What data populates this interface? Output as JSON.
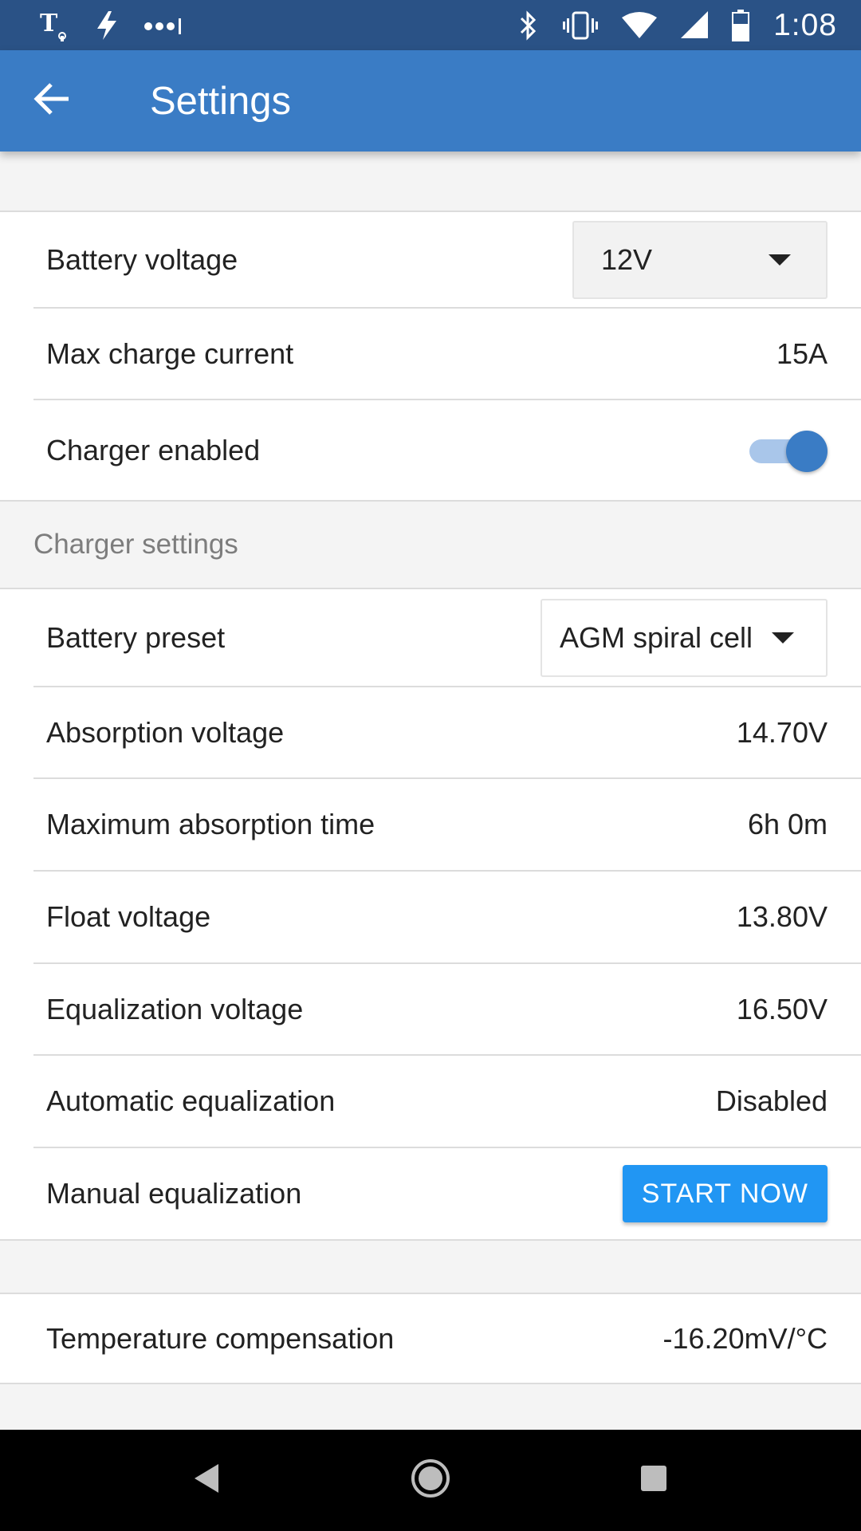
{
  "status_bar": {
    "carrier_icon": "tmobile-icon",
    "time": "1:08",
    "icons": [
      "tmobile-icon",
      "charging-bolt-icon",
      "signal-dots-icon",
      "bluetooth-icon",
      "vibrate-icon",
      "wifi-icon",
      "cell-signal-icon",
      "battery-icon"
    ]
  },
  "app_bar": {
    "title": "Settings",
    "back_icon": "arrow-left-icon",
    "color": "#3a7cc5"
  },
  "general": {
    "battery_voltage": {
      "label": "Battery voltage",
      "value": "12V"
    },
    "max_charge_current": {
      "label": "Max charge current",
      "value": "15A"
    },
    "charger_enabled": {
      "label": "Charger enabled",
      "on": true
    }
  },
  "charger_settings": {
    "header": "Charger settings",
    "battery_preset": {
      "label": "Battery preset",
      "value": "AGM spiral cell"
    },
    "rows": [
      {
        "label": "Absorption voltage",
        "value": "14.70V"
      },
      {
        "label": "Maximum absorption time",
        "value": "6h 0m"
      },
      {
        "label": "Float voltage",
        "value": "13.80V"
      },
      {
        "label": "Equalization voltage",
        "value": "16.50V"
      },
      {
        "label": "Automatic equalization",
        "value": "Disabled"
      }
    ],
    "manual_equalization": {
      "label": "Manual equalization",
      "button": "START NOW"
    }
  },
  "temperature": {
    "label": "Temperature compensation",
    "value": "-16.20mV/°C"
  },
  "nav_bar": {
    "icons": [
      "back-triangle-icon",
      "home-circle-icon",
      "recents-square-icon"
    ]
  },
  "colors": {
    "status_bar": "#2a5286",
    "accent": "#2196f3",
    "toggle_on": "#3a7cc5"
  }
}
